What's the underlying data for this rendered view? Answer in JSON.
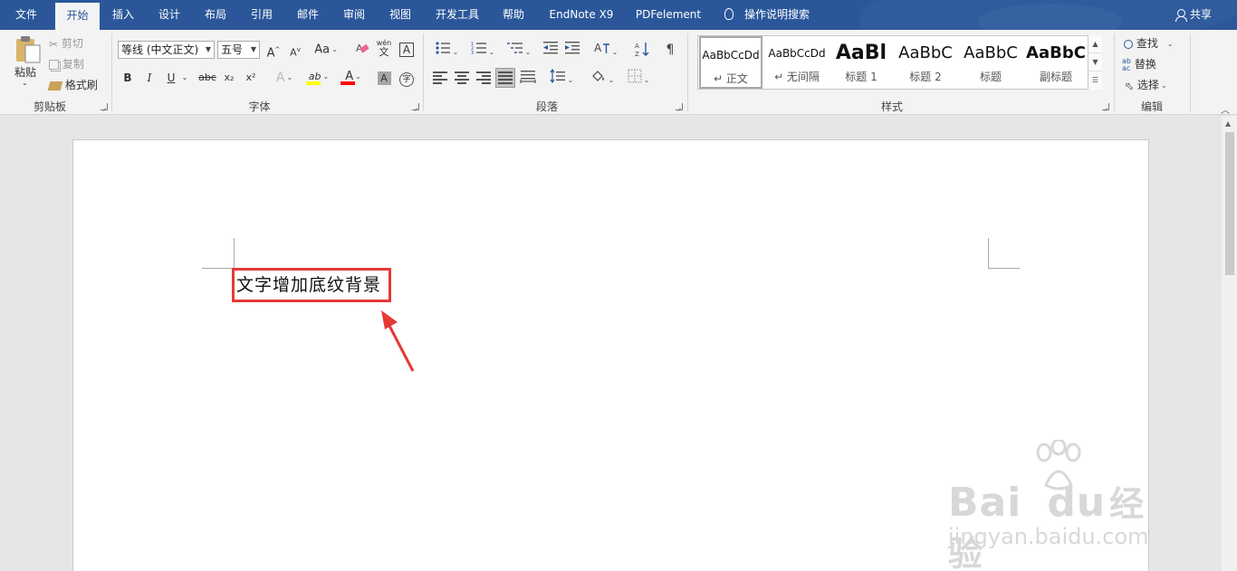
{
  "tabs": [
    {
      "id": "file",
      "label": "文件"
    },
    {
      "id": "home",
      "label": "开始",
      "active": true
    },
    {
      "id": "insert",
      "label": "插入"
    },
    {
      "id": "design",
      "label": "设计"
    },
    {
      "id": "layout",
      "label": "布局"
    },
    {
      "id": "references",
      "label": "引用"
    },
    {
      "id": "mailings",
      "label": "邮件"
    },
    {
      "id": "review",
      "label": "审阅"
    },
    {
      "id": "view",
      "label": "视图"
    },
    {
      "id": "developer",
      "label": "开发工具"
    },
    {
      "id": "help",
      "label": "帮助"
    },
    {
      "id": "endnote",
      "label": "EndNote X9"
    },
    {
      "id": "pdfelement",
      "label": "PDFelement"
    }
  ],
  "tell_me": "操作说明搜索",
  "share": "共享",
  "clipboard": {
    "group": "剪贴板",
    "paste": "粘贴",
    "cut": "剪切",
    "copy": "复制",
    "format_painter": "格式刷"
  },
  "font": {
    "group": "字体",
    "name": "等线 (中文正文)",
    "size": "五号",
    "grow": "A",
    "shrink": "A",
    "case": "Aa",
    "bold": "B",
    "italic": "I",
    "underline": "U",
    "strike": "abc",
    "subscript": "x₂",
    "superscript": "x²",
    "text_effects": "A",
    "highlight": "ab",
    "font_color": "A",
    "char_shading": "A",
    "enclose": "字",
    "phonetic": "wén",
    "border": "A"
  },
  "paragraph": {
    "group": "段落"
  },
  "styles": {
    "group": "样式",
    "items": [
      {
        "sample": "AaBbCcDd",
        "name": "↵ 正文"
      },
      {
        "sample": "AaBbCcDd",
        "name": "↵ 无间隔"
      },
      {
        "sample": "AaBl",
        "name": "标题 1"
      },
      {
        "sample": "AaBbC",
        "name": "标题 2"
      },
      {
        "sample": "AaBbC",
        "name": "标题"
      },
      {
        "sample": "AaBbC",
        "name": "副标题"
      }
    ]
  },
  "editing": {
    "group": "编辑",
    "find": "查找",
    "replace": "替换",
    "select": "选择"
  },
  "document": {
    "text": "文字增加底纹背景"
  },
  "watermark": {
    "brand": "Bai",
    "brand_suffix": "du",
    "product": "经验",
    "url": "jingyan.baidu.com"
  },
  "colors": {
    "brand_blue": "#2b579a",
    "callout_red": "#e53935",
    "highlight_yellow": "#ffff00",
    "font_red": "#ff0000"
  }
}
